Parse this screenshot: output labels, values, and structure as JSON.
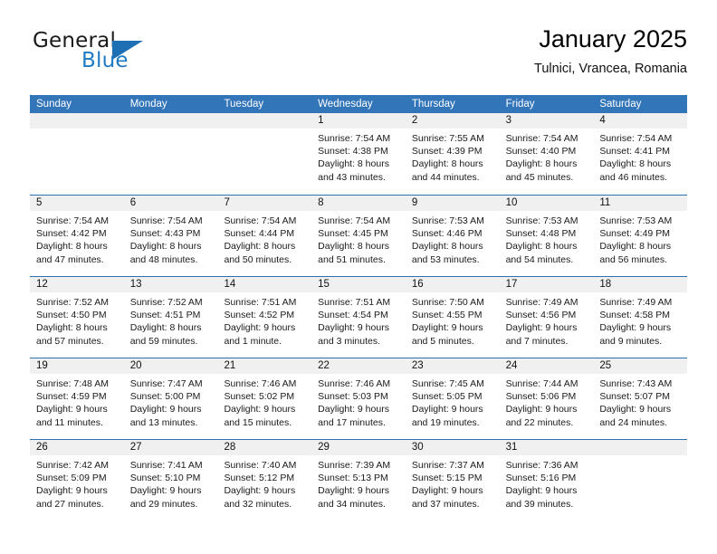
{
  "brand": {
    "word1": "General",
    "word2": "Blue",
    "triangle_color": "#1f6fb5"
  },
  "header": {
    "title": "January 2025",
    "subtitle": "Tulnici, Vrancea, Romania"
  },
  "colors": {
    "header_blue": "#3275b8",
    "daynum_band": "#f0f0f0",
    "row_divider": "#2f6fae"
  },
  "weekdays": [
    "Sunday",
    "Monday",
    "Tuesday",
    "Wednesday",
    "Thursday",
    "Friday",
    "Saturday"
  ],
  "weeks": [
    [
      {
        "day": "",
        "sunrise": "",
        "sunset": "",
        "daylight1": "",
        "daylight2": ""
      },
      {
        "day": "",
        "sunrise": "",
        "sunset": "",
        "daylight1": "",
        "daylight2": ""
      },
      {
        "day": "",
        "sunrise": "",
        "sunset": "",
        "daylight1": "",
        "daylight2": ""
      },
      {
        "day": "1",
        "sunrise": "Sunrise: 7:54 AM",
        "sunset": "Sunset: 4:38 PM",
        "daylight1": "Daylight: 8 hours",
        "daylight2": "and 43 minutes."
      },
      {
        "day": "2",
        "sunrise": "Sunrise: 7:55 AM",
        "sunset": "Sunset: 4:39 PM",
        "daylight1": "Daylight: 8 hours",
        "daylight2": "and 44 minutes."
      },
      {
        "day": "3",
        "sunrise": "Sunrise: 7:54 AM",
        "sunset": "Sunset: 4:40 PM",
        "daylight1": "Daylight: 8 hours",
        "daylight2": "and 45 minutes."
      },
      {
        "day": "4",
        "sunrise": "Sunrise: 7:54 AM",
        "sunset": "Sunset: 4:41 PM",
        "daylight1": "Daylight: 8 hours",
        "daylight2": "and 46 minutes."
      }
    ],
    [
      {
        "day": "5",
        "sunrise": "Sunrise: 7:54 AM",
        "sunset": "Sunset: 4:42 PM",
        "daylight1": "Daylight: 8 hours",
        "daylight2": "and 47 minutes."
      },
      {
        "day": "6",
        "sunrise": "Sunrise: 7:54 AM",
        "sunset": "Sunset: 4:43 PM",
        "daylight1": "Daylight: 8 hours",
        "daylight2": "and 48 minutes."
      },
      {
        "day": "7",
        "sunrise": "Sunrise: 7:54 AM",
        "sunset": "Sunset: 4:44 PM",
        "daylight1": "Daylight: 8 hours",
        "daylight2": "and 50 minutes."
      },
      {
        "day": "8",
        "sunrise": "Sunrise: 7:54 AM",
        "sunset": "Sunset: 4:45 PM",
        "daylight1": "Daylight: 8 hours",
        "daylight2": "and 51 minutes."
      },
      {
        "day": "9",
        "sunrise": "Sunrise: 7:53 AM",
        "sunset": "Sunset: 4:46 PM",
        "daylight1": "Daylight: 8 hours",
        "daylight2": "and 53 minutes."
      },
      {
        "day": "10",
        "sunrise": "Sunrise: 7:53 AM",
        "sunset": "Sunset: 4:48 PM",
        "daylight1": "Daylight: 8 hours",
        "daylight2": "and 54 minutes."
      },
      {
        "day": "11",
        "sunrise": "Sunrise: 7:53 AM",
        "sunset": "Sunset: 4:49 PM",
        "daylight1": "Daylight: 8 hours",
        "daylight2": "and 56 minutes."
      }
    ],
    [
      {
        "day": "12",
        "sunrise": "Sunrise: 7:52 AM",
        "sunset": "Sunset: 4:50 PM",
        "daylight1": "Daylight: 8 hours",
        "daylight2": "and 57 minutes."
      },
      {
        "day": "13",
        "sunrise": "Sunrise: 7:52 AM",
        "sunset": "Sunset: 4:51 PM",
        "daylight1": "Daylight: 8 hours",
        "daylight2": "and 59 minutes."
      },
      {
        "day": "14",
        "sunrise": "Sunrise: 7:51 AM",
        "sunset": "Sunset: 4:52 PM",
        "daylight1": "Daylight: 9 hours",
        "daylight2": "and 1 minute."
      },
      {
        "day": "15",
        "sunrise": "Sunrise: 7:51 AM",
        "sunset": "Sunset: 4:54 PM",
        "daylight1": "Daylight: 9 hours",
        "daylight2": "and 3 minutes."
      },
      {
        "day": "16",
        "sunrise": "Sunrise: 7:50 AM",
        "sunset": "Sunset: 4:55 PM",
        "daylight1": "Daylight: 9 hours",
        "daylight2": "and 5 minutes."
      },
      {
        "day": "17",
        "sunrise": "Sunrise: 7:49 AM",
        "sunset": "Sunset: 4:56 PM",
        "daylight1": "Daylight: 9 hours",
        "daylight2": "and 7 minutes."
      },
      {
        "day": "18",
        "sunrise": "Sunrise: 7:49 AM",
        "sunset": "Sunset: 4:58 PM",
        "daylight1": "Daylight: 9 hours",
        "daylight2": "and 9 minutes."
      }
    ],
    [
      {
        "day": "19",
        "sunrise": "Sunrise: 7:48 AM",
        "sunset": "Sunset: 4:59 PM",
        "daylight1": "Daylight: 9 hours",
        "daylight2": "and 11 minutes."
      },
      {
        "day": "20",
        "sunrise": "Sunrise: 7:47 AM",
        "sunset": "Sunset: 5:00 PM",
        "daylight1": "Daylight: 9 hours",
        "daylight2": "and 13 minutes."
      },
      {
        "day": "21",
        "sunrise": "Sunrise: 7:46 AM",
        "sunset": "Sunset: 5:02 PM",
        "daylight1": "Daylight: 9 hours",
        "daylight2": "and 15 minutes."
      },
      {
        "day": "22",
        "sunrise": "Sunrise: 7:46 AM",
        "sunset": "Sunset: 5:03 PM",
        "daylight1": "Daylight: 9 hours",
        "daylight2": "and 17 minutes."
      },
      {
        "day": "23",
        "sunrise": "Sunrise: 7:45 AM",
        "sunset": "Sunset: 5:05 PM",
        "daylight1": "Daylight: 9 hours",
        "daylight2": "and 19 minutes."
      },
      {
        "day": "24",
        "sunrise": "Sunrise: 7:44 AM",
        "sunset": "Sunset: 5:06 PM",
        "daylight1": "Daylight: 9 hours",
        "daylight2": "and 22 minutes."
      },
      {
        "day": "25",
        "sunrise": "Sunrise: 7:43 AM",
        "sunset": "Sunset: 5:07 PM",
        "daylight1": "Daylight: 9 hours",
        "daylight2": "and 24 minutes."
      }
    ],
    [
      {
        "day": "26",
        "sunrise": "Sunrise: 7:42 AM",
        "sunset": "Sunset: 5:09 PM",
        "daylight1": "Daylight: 9 hours",
        "daylight2": "and 27 minutes."
      },
      {
        "day": "27",
        "sunrise": "Sunrise: 7:41 AM",
        "sunset": "Sunset: 5:10 PM",
        "daylight1": "Daylight: 9 hours",
        "daylight2": "and 29 minutes."
      },
      {
        "day": "28",
        "sunrise": "Sunrise: 7:40 AM",
        "sunset": "Sunset: 5:12 PM",
        "daylight1": "Daylight: 9 hours",
        "daylight2": "and 32 minutes."
      },
      {
        "day": "29",
        "sunrise": "Sunrise: 7:39 AM",
        "sunset": "Sunset: 5:13 PM",
        "daylight1": "Daylight: 9 hours",
        "daylight2": "and 34 minutes."
      },
      {
        "day": "30",
        "sunrise": "Sunrise: 7:37 AM",
        "sunset": "Sunset: 5:15 PM",
        "daylight1": "Daylight: 9 hours",
        "daylight2": "and 37 minutes."
      },
      {
        "day": "31",
        "sunrise": "Sunrise: 7:36 AM",
        "sunset": "Sunset: 5:16 PM",
        "daylight1": "Daylight: 9 hours",
        "daylight2": "and 39 minutes."
      },
      {
        "day": "",
        "sunrise": "",
        "sunset": "",
        "daylight1": "",
        "daylight2": ""
      }
    ]
  ]
}
